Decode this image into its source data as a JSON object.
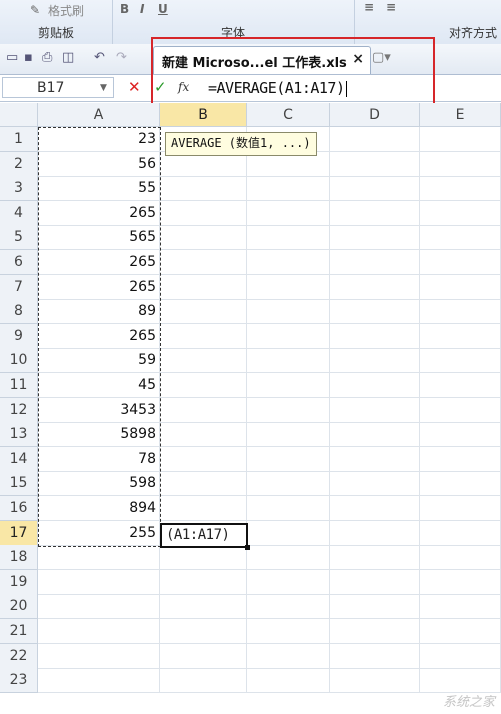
{
  "ribbon": {
    "format_painter": "格式刷",
    "clipboard_label": "剪贴板",
    "font_label": "字体",
    "align_label": "对齐方式",
    "bold": "B",
    "italic": "I",
    "underline": "U"
  },
  "tab": {
    "title": "新建 Microso...el 工作表.xls",
    "close": "×"
  },
  "formula_bar": {
    "name_box": "B17",
    "cancel": "✕",
    "enter": "✓",
    "fx": "fx",
    "formula": "=AVERAGE(A1:A17)"
  },
  "columns": [
    "A",
    "B",
    "C",
    "D",
    "E"
  ],
  "active_column": "B",
  "rows": [
    "1",
    "2",
    "3",
    "4",
    "5",
    "6",
    "7",
    "8",
    "9",
    "10",
    "11",
    "12",
    "13",
    "14",
    "15",
    "16",
    "17",
    "18",
    "19",
    "20",
    "21",
    "22",
    "23"
  ],
  "active_row": "17",
  "column_a_values": [
    "23",
    "56",
    "55",
    "265",
    "565",
    "265",
    "265",
    "89",
    "265",
    "59",
    "45",
    "3453",
    "5898",
    "78",
    "598",
    "894",
    "255"
  ],
  "active_cell_text": "(A1:A17)",
  "tooltip": "AVERAGE (数值1, ...)",
  "watermark": "系统之家"
}
